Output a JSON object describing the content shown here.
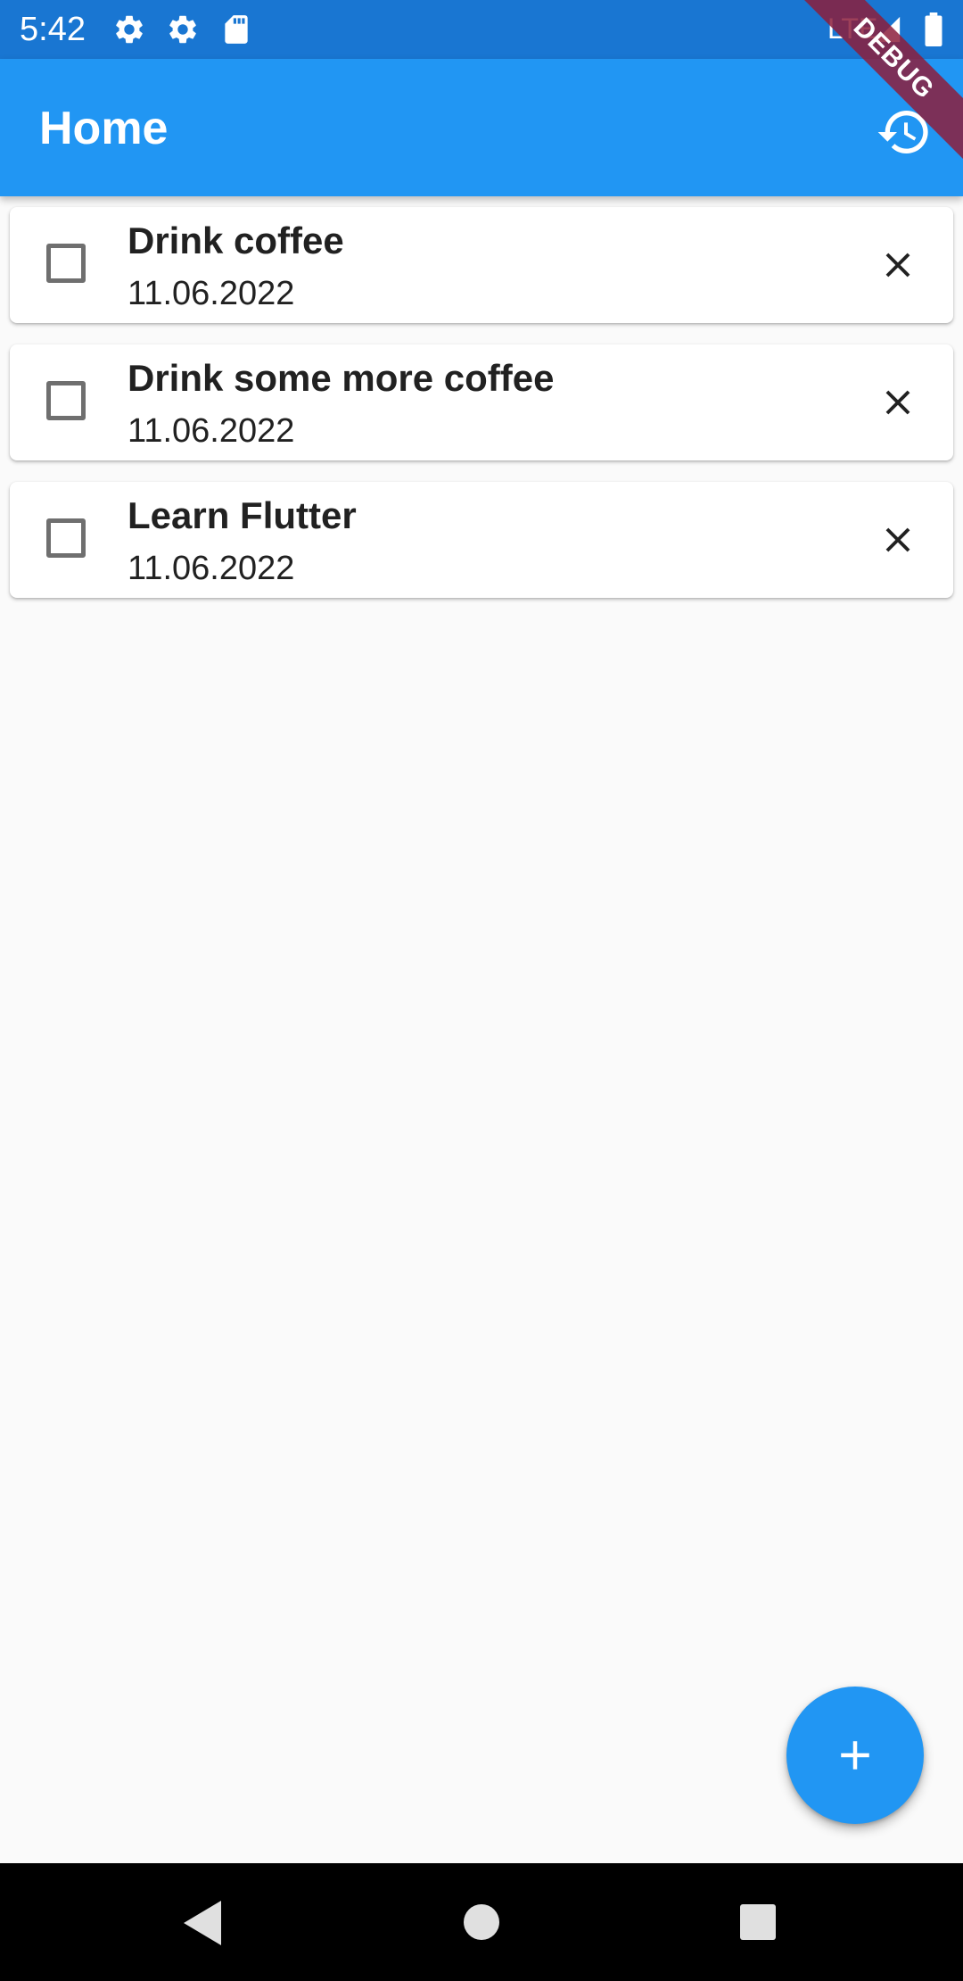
{
  "status_bar": {
    "time": "5:42",
    "network": "LTE",
    "icons": [
      "gear-icon",
      "gear-icon",
      "sd-card-icon",
      "signal-icon",
      "battery-icon"
    ]
  },
  "app_bar": {
    "title": "Home",
    "action_icon": "history-icon"
  },
  "debug_banner": "DEBUG",
  "todos": [
    {
      "title": "Drink coffee",
      "date": "11.06.2022",
      "checked": false
    },
    {
      "title": "Drink some more coffee",
      "date": "11.06.2022",
      "checked": false
    },
    {
      "title": "Learn Flutter",
      "date": "11.06.2022",
      "checked": false
    }
  ],
  "fab": {
    "icon": "plus-icon"
  },
  "nav_bar": {
    "icons": [
      "back-icon",
      "home-icon",
      "recents-icon"
    ]
  },
  "colors": {
    "status_bar": "#1976d2",
    "app_bar": "#2196f3",
    "background": "#fafafa",
    "fab": "#2196f3",
    "debug_banner": "#8c1e3c"
  }
}
